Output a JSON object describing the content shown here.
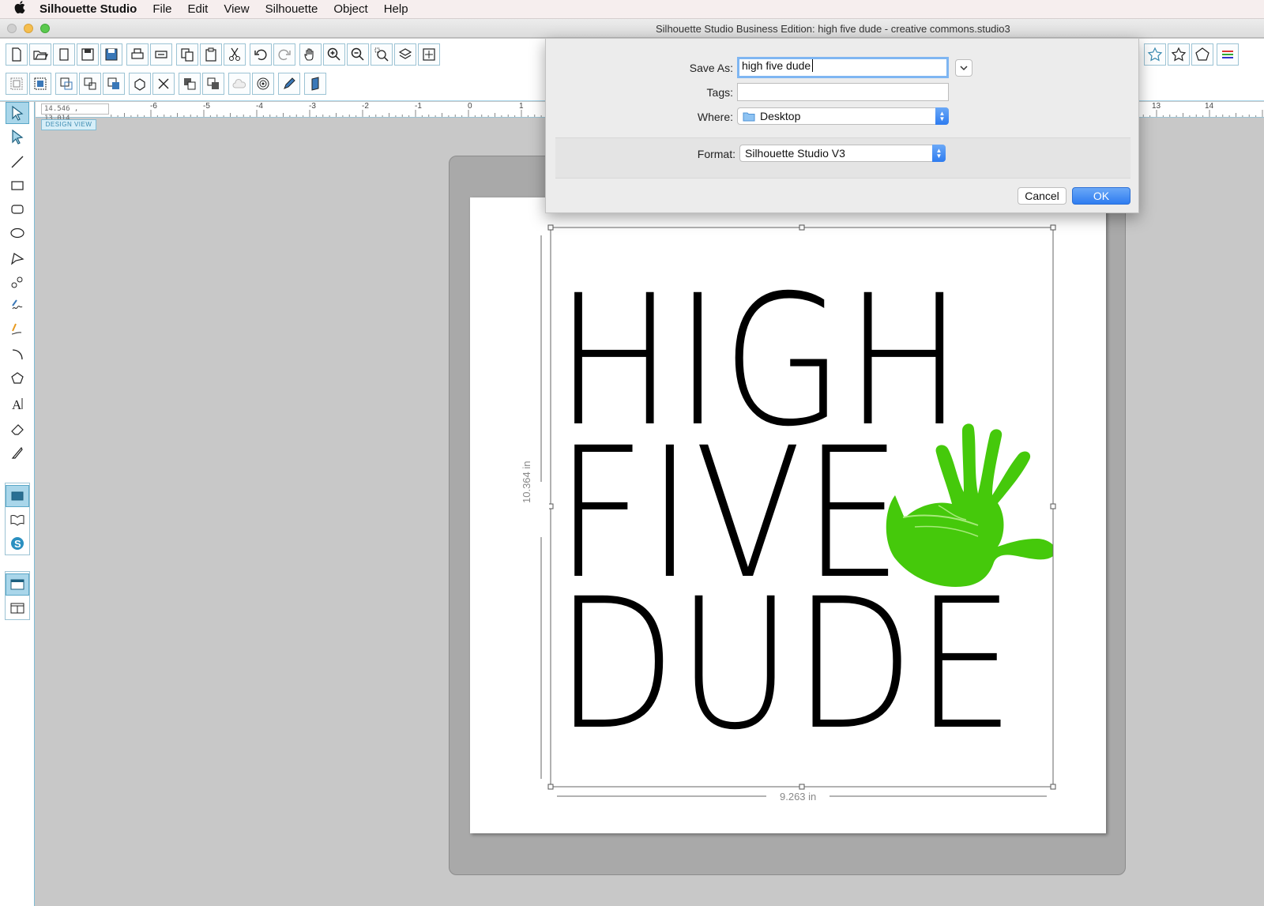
{
  "menubar": {
    "app_name": "Silhouette Studio",
    "items": [
      "File",
      "Edit",
      "View",
      "Silhouette",
      "Object",
      "Help"
    ]
  },
  "window": {
    "title": "Silhouette Studio Business Edition: high five dude - creative commons.studio3"
  },
  "ruler": {
    "coords": "14.546 , 13.014",
    "labels_left": [
      "-6",
      "-5",
      "-4",
      "-3",
      "-2",
      "-1",
      "0",
      "1"
    ],
    "labels_right": [
      "13",
      "14"
    ],
    "design_view_label": "DESIGN VIEW"
  },
  "design": {
    "line1": "HIGH",
    "line2": "FIVE",
    "line3": "DUDE",
    "height_label": "10.364 in",
    "width_label": "9.263 in"
  },
  "dialog": {
    "save_as_label": "Save As:",
    "save_as_value": "high five dude",
    "tags_label": "Tags:",
    "tags_value": "",
    "where_label": "Where:",
    "where_value": "Desktop",
    "format_label": "Format:",
    "format_value": "Silhouette Studio V3",
    "cancel_label": "Cancel",
    "ok_label": "OK"
  },
  "colors": {
    "accent": "#3e8ef2",
    "hand_green": "#45c90b",
    "ui_blue": "#7fbcd6"
  }
}
